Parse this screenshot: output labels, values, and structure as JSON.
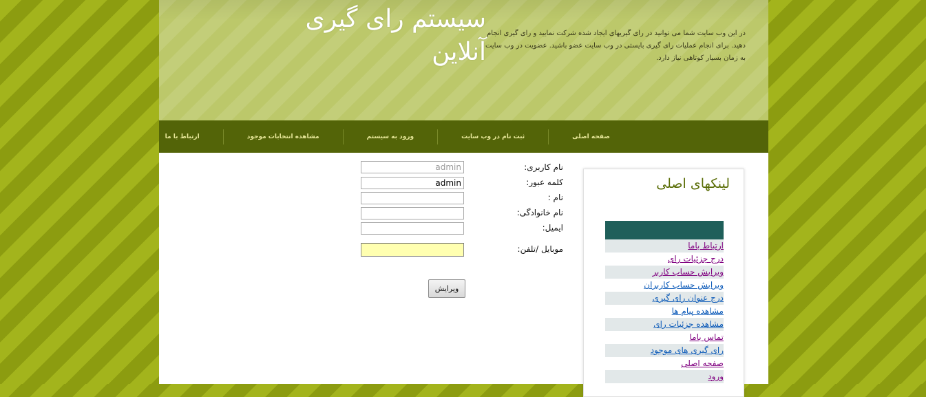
{
  "header": {
    "site_title": "سیستم رای گیری آنلاین",
    "intro": "در این وب سایت شما می توانید در رای گیریهای ایجاد شده شرکت نمایید و رای گیری انجام دهید. برای انجام عملیات رای گیری بایستی در وب سایت عضو باشید. عضویت در وب سایت به زمان بسیار کوتاهی نیاز دارد."
  },
  "nav": {
    "items": [
      {
        "label": "صفحه اصلی"
      },
      {
        "label": "ثبت نام در وب سایت"
      },
      {
        "label": "ورود به سیستم"
      },
      {
        "label": "مشاهده انتخابات موجود"
      },
      {
        "label": "ارتباط با ما"
      }
    ]
  },
  "form": {
    "username_label": "نام کاربری:",
    "username_placeholder": "admin",
    "password_label": "کلمه عبور:",
    "password_value": "admin",
    "first_name_label": "نام :",
    "first_name_value": "",
    "last_name_label": "نام خانوادگی:",
    "last_name_value": "",
    "email_label": "ایمیل:",
    "email_value": "",
    "mobile_label": "موبایل /تلفن:",
    "mobile_value": "",
    "edit_button": "ویرایش"
  },
  "sidebar": {
    "title": "لینکهای اصلی",
    "links": [
      {
        "label": "ارتباط باما",
        "visited": true
      },
      {
        "label": "درج جزئیات رای",
        "visited": true
      },
      {
        "label": "ویرایش حساب کاربر",
        "visited": true
      },
      {
        "label": "ویرایش حساب کاربران",
        "visited": false
      },
      {
        "label": "درج عنوان رای گیری",
        "visited": false
      },
      {
        "label": "مشاهده پیام ها",
        "visited": false
      },
      {
        "label": "مشاهده جزئیات رای",
        "visited": false
      },
      {
        "label": "تماس باما",
        "visited": true
      },
      {
        "label": "رای گیری های موجود",
        "visited": false
      },
      {
        "label": "صفحه اصلی",
        "visited": true
      },
      {
        "label": "ورود",
        "visited": true
      }
    ]
  },
  "colors": {
    "background": "#9aab16",
    "header": "#bcc86a",
    "navbar": "#536408",
    "nav_text": "#e8e89a",
    "sidebar_title": "#5a6d06",
    "sidebar_bar": "#1f5f5a",
    "visited_link": "#800080",
    "link": "#0a59b8",
    "mobile_field": "#ffffb0"
  }
}
